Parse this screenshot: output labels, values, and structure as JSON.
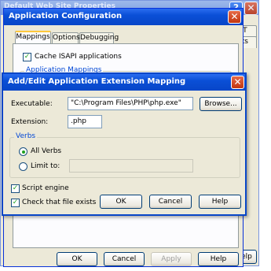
{
  "background_window": {
    "title": "Default Web Site Properties",
    "help_button": "?",
    "close_button": "✕",
    "tab_fragment_1": "ET",
    "tab_fragment_2": "nts",
    "help_fragment": "elp"
  },
  "app_config": {
    "title": "Application Configuration",
    "close_button": "✕",
    "tabs": [
      {
        "label": "Mappings",
        "active": true
      },
      {
        "label": "Options",
        "active": false
      },
      {
        "label": "Debugging",
        "active": false
      }
    ],
    "cache_isapi_label": "Cache ISAPI applications",
    "cache_isapi_checked": true,
    "mappings_group_label": "Application Mappings",
    "buttons": {
      "ok": "OK",
      "cancel": "Cancel",
      "apply": "Apply",
      "help": "Help"
    }
  },
  "dialog": {
    "title": "Add/Edit Application Extension Mapping",
    "close_button": "✕",
    "executable_label": "Executable:",
    "executable_value": "\"C:\\Program Files\\PHP\\php.exe\"",
    "browse_button": "Browse...",
    "extension_label": "Extension:",
    "extension_value": ".php",
    "verbs_group_label": "Verbs",
    "all_verbs_label": "All Verbs",
    "limit_to_label": "Limit to:",
    "limit_to_value": "",
    "script_engine_label": "Script engine",
    "script_engine_checked": true,
    "check_file_label": "Check that file exists",
    "check_file_checked": true,
    "checkmark": "✓",
    "buttons": {
      "ok": "OK",
      "cancel": "Cancel",
      "help": "Help"
    }
  },
  "colors": {
    "title_active": "#0a4fd6",
    "title_inactive": "#7a9ce0",
    "window_face": "#ece9d8",
    "group_label": "#0046d5",
    "check_green": "#21a121"
  }
}
